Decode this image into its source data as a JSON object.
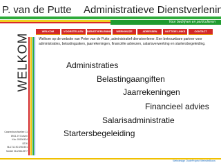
{
  "header": {
    "brand": "P. van de Putte",
    "subtitle": "Administratieve Dienstverlening",
    "tagline": "Voor bedrijven en particulieren"
  },
  "nav": {
    "items": [
      {
        "label": "WELKOM"
      },
      {
        "label": "VOORSTELLEN"
      },
      {
        "label": "DIENSTVERLENING"
      },
      {
        "label": "WERKWIJZE"
      },
      {
        "label": "ADRESSEN"
      },
      {
        "label": "NUTTIGE LINKS"
      },
      {
        "label": "CONTACT"
      }
    ]
  },
  "side": {
    "word": "WELKOM"
  },
  "intro": {
    "text": "Welkom op de website van Peter van de Putte, administratief dienstverlener. Een betrouwbare partner voor administraties, belastingzaken, jaarrekeningen, financiële adviezen, salarisverwerking en startersbegeleiding."
  },
  "services": [
    "Administraties",
    "Belastingaangiften",
    "Jaarrekeningen",
    "Financieel advies",
    "Salarisadministratie",
    "Startersbegeleiding"
  ],
  "address": {
    "line1": "Cannenburchsellee 11",
    "line2": "8921 JV Duiven",
    "line3": "Kvk: 09150434",
    "line4": "BTW NL1711.90.196.B01",
    "line5": "Mobiel 06-23614977"
  },
  "footer": {
    "credit": "Webdesign OudeProjekt WebsiteBouw"
  }
}
